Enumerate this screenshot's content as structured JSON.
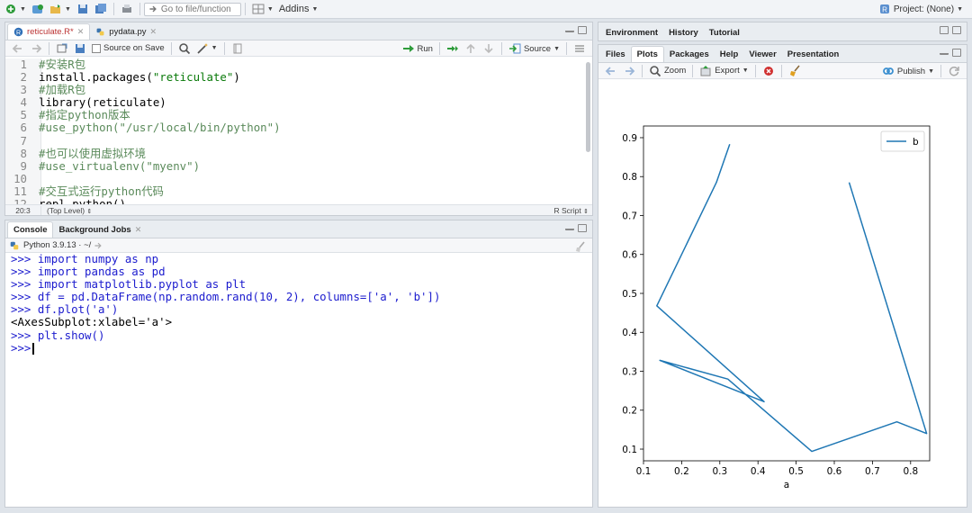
{
  "toolbar": {
    "goto_placeholder": "Go to file/function",
    "addins_label": "Addins",
    "project_label": "Project: (None)"
  },
  "editor": {
    "tabs": [
      {
        "label": "reticulate.R*",
        "active": true
      },
      {
        "label": "pydata.py",
        "active": false
      }
    ],
    "source_on_save_label": "Source on Save",
    "run_label": "Run",
    "source_label": "Source",
    "lines": [
      {
        "n": "1",
        "text": "#安装R包",
        "kind": "comment"
      },
      {
        "n": "2",
        "pre": "install.packages(",
        "str": "\"reticulate\"",
        "post": ")",
        "kind": "code"
      },
      {
        "n": "3",
        "text": "#加载R包",
        "kind": "comment"
      },
      {
        "n": "4",
        "text": "library(reticulate)",
        "kind": "plain"
      },
      {
        "n": "5",
        "text": "#指定python版本",
        "kind": "comment"
      },
      {
        "n": "6",
        "text": "#use_python(\"/usr/local/bin/python\")",
        "kind": "comment"
      },
      {
        "n": "7",
        "text": "",
        "kind": "plain"
      },
      {
        "n": "8",
        "text": "#也可以使用虚拟环境",
        "kind": "comment"
      },
      {
        "n": "9",
        "text": "#use_virtualenv(\"myenv\")",
        "kind": "comment"
      },
      {
        "n": "10",
        "text": "",
        "kind": "plain"
      },
      {
        "n": "11",
        "text": "#交互式运行python代码",
        "kind": "comment"
      },
      {
        "n": "12",
        "text": "repl_python()",
        "kind": "plain"
      }
    ],
    "status_position": "20:3",
    "status_scope": "(Top Level)",
    "status_filetype": "R Script"
  },
  "console": {
    "tabs": [
      {
        "label": "Console",
        "active": true
      },
      {
        "label": "Background Jobs",
        "active": false
      }
    ],
    "env_label": "Python 3.9.13 · ~/",
    "lines": [
      {
        "text": ">>> import numpy as np",
        "kind": "prompt"
      },
      {
        "text": ">>> import pandas as pd",
        "kind": "prompt"
      },
      {
        "text": ">>> import matplotlib.pyplot as plt",
        "kind": "prompt"
      },
      {
        "text": ">>> df = pd.DataFrame(np.random.rand(10, 2), columns=['a', 'b'])",
        "kind": "prompt"
      },
      {
        "text": ">>> df.plot('a')",
        "kind": "prompt"
      },
      {
        "text": "<AxesSubplot:xlabel='a'>",
        "kind": "output"
      },
      {
        "text": ">>> plt.show()",
        "kind": "prompt"
      },
      {
        "text": ">>>",
        "kind": "prompt"
      }
    ]
  },
  "env_tabs": [
    "Environment",
    "History",
    "Tutorial"
  ],
  "files_tabs": [
    "Files",
    "Plots",
    "Packages",
    "Help",
    "Viewer",
    "Presentation"
  ],
  "files_active": "Plots",
  "plot_toolbar": {
    "zoom_label": "Zoom",
    "export_label": "Export",
    "publish_label": "Publish"
  },
  "colors": {
    "line": "#1f77b4",
    "console_prompt": "#1b1bce"
  },
  "chart_data": {
    "type": "line",
    "xlabel": "a",
    "ylabel": "",
    "title": "",
    "xlim": [
      0.1,
      0.85
    ],
    "ylim": [
      0.07,
      0.93
    ],
    "xticks": [
      0.1,
      0.2,
      0.3,
      0.4,
      0.5,
      0.6,
      0.7,
      0.8
    ],
    "yticks": [
      0.1,
      0.2,
      0.3,
      0.4,
      0.5,
      0.6,
      0.7,
      0.8,
      0.9
    ],
    "legend_position": "top-right",
    "series": [
      {
        "name": "b",
        "x": [
          0.639,
          0.842,
          0.764,
          0.541,
          0.321,
          0.143,
          0.416,
          0.135,
          0.291,
          0.326
        ],
        "y": [
          0.785,
          0.14,
          0.17,
          0.094,
          0.28,
          0.328,
          0.222,
          0.468,
          0.785,
          0.883
        ]
      }
    ]
  }
}
